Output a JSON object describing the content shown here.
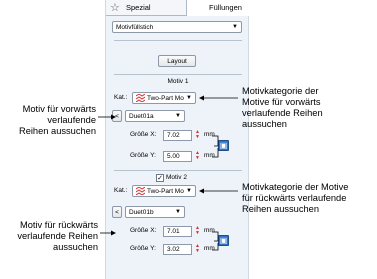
{
  "tabs": [
    {
      "label": "Spezial",
      "icon": "star-icon"
    },
    {
      "label": "Füllungen",
      "icon": "fill-bucket-icon"
    }
  ],
  "fill_type_select": {
    "value": "Motivfüllstich"
  },
  "layout_button": {
    "label": "Layout"
  },
  "motif1": {
    "title": "Motiv 1",
    "category_label": "Kat.:",
    "category_value": "Two-Part Mo",
    "prev_button": "<",
    "motif_value": "Duet01a",
    "size_x_label": "Größe X:",
    "size_x_value": "7.02",
    "size_y_label": "Größe Y:",
    "size_y_value": "5.00",
    "unit": "mm"
  },
  "motif2": {
    "title": "Motiv 2",
    "checkbox_checked": true,
    "category_label": "Kat.:",
    "category_value": "Two-Part Mo",
    "prev_button": "<",
    "motif_value": "Duet01b",
    "size_x_label": "Größe X:",
    "size_x_value": "7.01",
    "size_y_label": "Größe Y:",
    "size_y_value": "3.02",
    "unit": "mm"
  },
  "annotations": {
    "left_top": [
      "Motiv für vorwärts",
      "verlaufende",
      "Reihen aussuchen"
    ],
    "right_top": [
      "Motivkategorie der",
      "Motive für vorwärts",
      "verlaufende Reihen",
      "aussuchen"
    ],
    "left_bottom": [
      "Motiv für rückwärts",
      "verlaufende Reihen",
      "aussuchen"
    ],
    "right_bottom": [
      "Motivkategorie der Motive",
      "für rückwärts verlaufende",
      "Reihen aussuchen"
    ]
  },
  "colors": {
    "panel_bg": "#eef3f9",
    "accent_red": "#d03030",
    "lock_blue": "#2e72c7"
  }
}
